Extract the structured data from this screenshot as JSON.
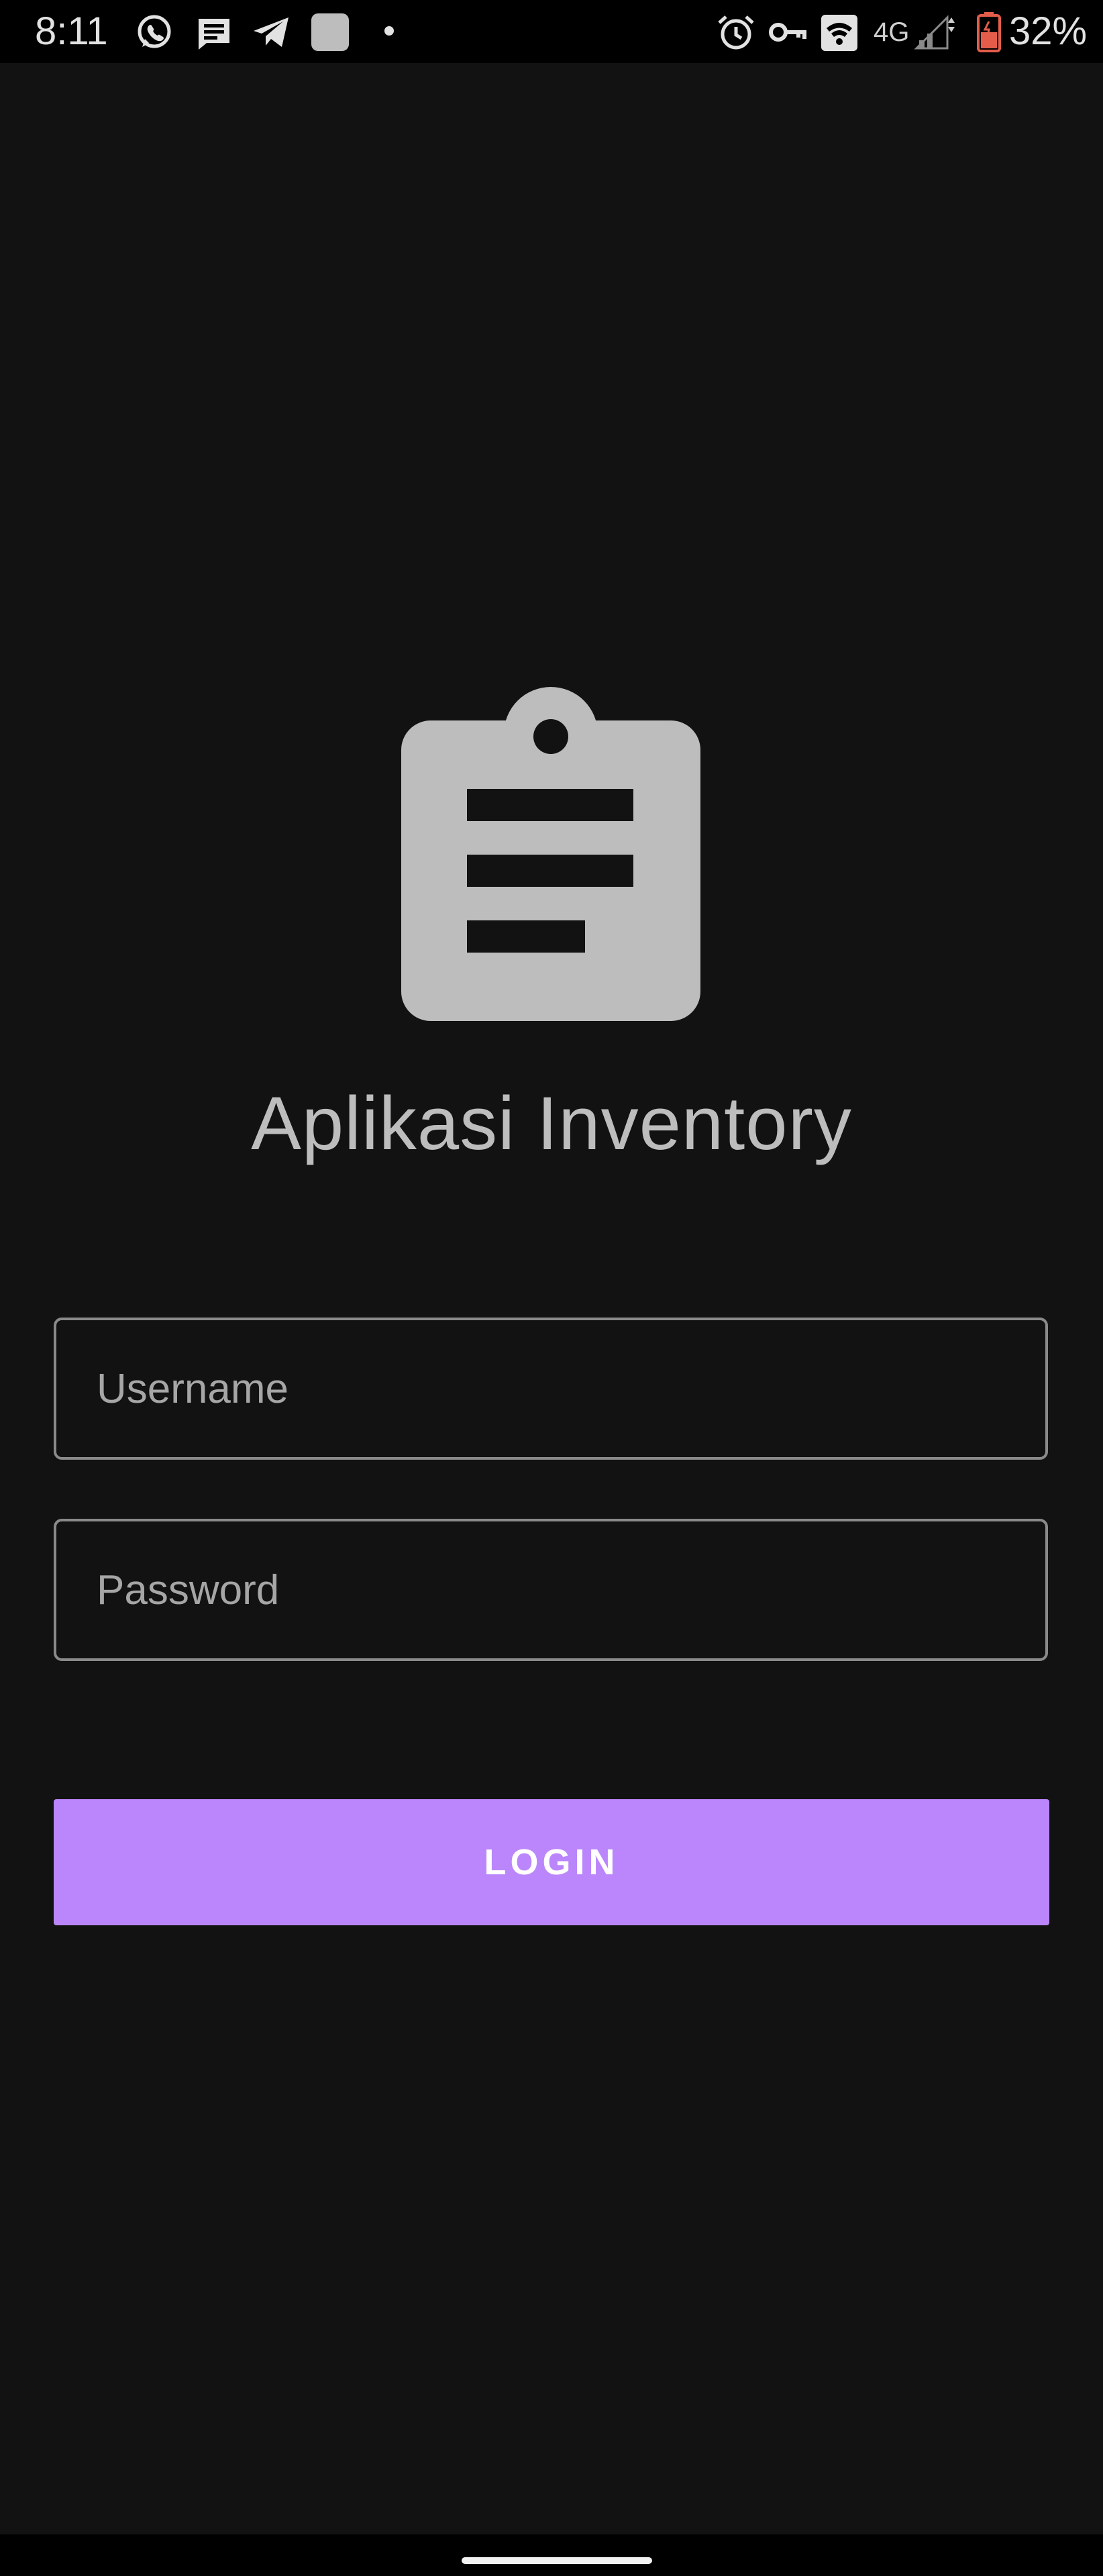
{
  "status_bar": {
    "time": "8:11",
    "network": "4G",
    "battery_percent": "32%",
    "icons": [
      "whatsapp-icon",
      "message-icon",
      "telegram-icon",
      "app-icon",
      "dot-icon",
      "alarm-icon",
      "vpn-key-icon",
      "wifi-icon",
      "signal-icon",
      "battery-icon"
    ],
    "battery_color": "#e35d4a"
  },
  "app": {
    "logo_icon": "clipboard-icon",
    "title": "Aplikasi Inventory"
  },
  "form": {
    "username_placeholder": "Username",
    "username_value": "",
    "password_placeholder": "Password",
    "password_value": "",
    "login_label": "LOGIN"
  },
  "colors": {
    "background": "#121212",
    "accent": "#bb86fc",
    "icon_gray": "#bdbdbd"
  }
}
